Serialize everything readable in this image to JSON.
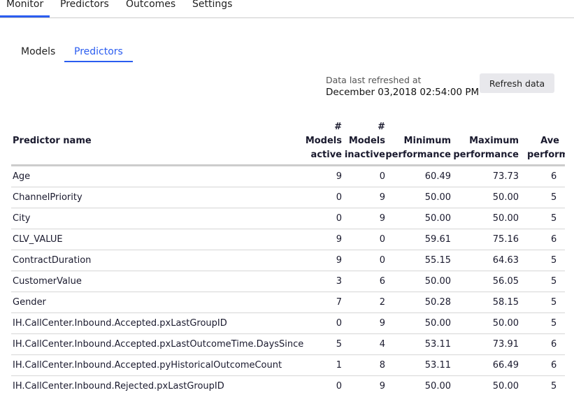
{
  "top_nav": [
    "Monitor",
    "Predictors",
    "Outcomes",
    "Settings"
  ],
  "sub_tabs": [
    "Models",
    "Predictors"
  ],
  "refresh": {
    "label": "Data last refreshed at",
    "time": "December 03,2018 02:54:00 PM",
    "button": "Refresh data"
  },
  "table": {
    "headers": {
      "name": "Predictor name",
      "active": [
        "#",
        "Models",
        "active"
      ],
      "inactive": [
        "#",
        "Models",
        "inactive"
      ],
      "min": [
        "Minimum",
        "performance"
      ],
      "max": [
        "Maximum",
        "performance"
      ],
      "avg": [
        "Ave",
        "perform"
      ]
    },
    "rows": [
      [
        "Age",
        "9",
        "0",
        "60.49",
        "73.73",
        "6"
      ],
      [
        "ChannelPriority",
        "0",
        "9",
        "50.00",
        "50.00",
        "5"
      ],
      [
        "City",
        "0",
        "9",
        "50.00",
        "50.00",
        "5"
      ],
      [
        "CLV_VALUE",
        "9",
        "0",
        "59.61",
        "75.16",
        "6"
      ],
      [
        "ContractDuration",
        "9",
        "0",
        "55.15",
        "64.63",
        "5"
      ],
      [
        "CustomerValue",
        "3",
        "6",
        "50.00",
        "56.05",
        "5"
      ],
      [
        "Gender",
        "7",
        "2",
        "50.28",
        "58.15",
        "5"
      ],
      [
        "IH.CallCenter.Inbound.Accepted.pxLastGroupID",
        "0",
        "9",
        "50.00",
        "50.00",
        "5"
      ],
      [
        "IH.CallCenter.Inbound.Accepted.pxLastOutcomeTime.DaysSince",
        "5",
        "4",
        "53.11",
        "73.91",
        "6"
      ],
      [
        "IH.CallCenter.Inbound.Accepted.pyHistoricalOutcomeCount",
        "1",
        "8",
        "53.11",
        "66.49",
        "6"
      ],
      [
        "IH.CallCenter.Inbound.Rejected.pxLastGroupID",
        "0",
        "9",
        "50.00",
        "50.00",
        "5"
      ]
    ]
  }
}
